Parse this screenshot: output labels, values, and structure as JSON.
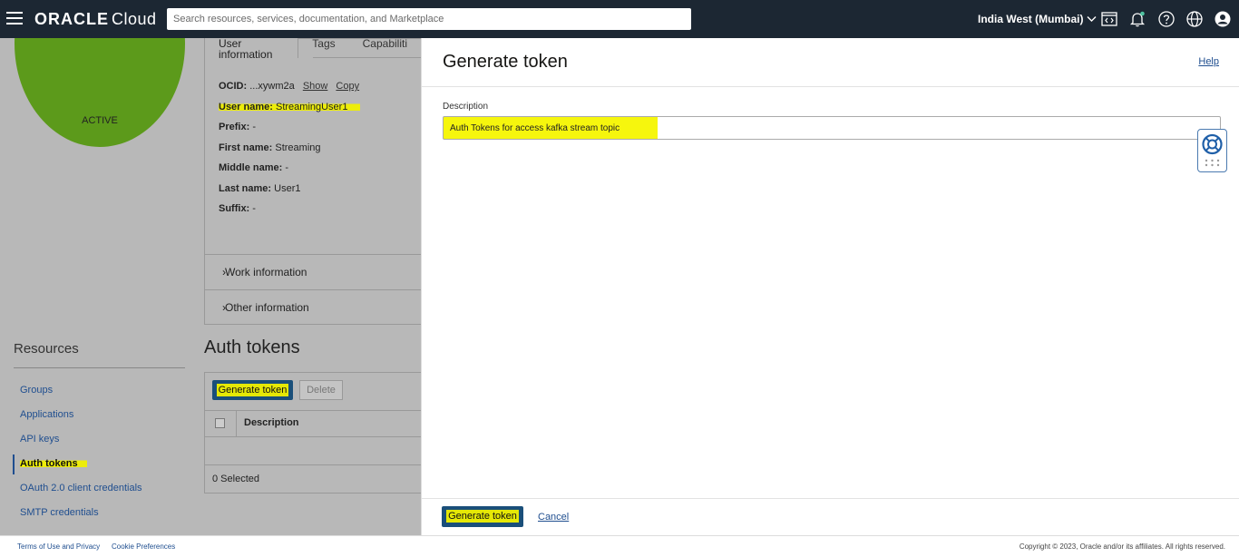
{
  "topbar": {
    "logo_oracle": "ORACLE",
    "logo_cloud": "Cloud",
    "search_placeholder": "Search resources, services, documentation, and Marketplace",
    "region": "India West (Mumbai)"
  },
  "user": {
    "status": "ACTIVE",
    "tabs": [
      "User information",
      "Tags",
      "Capabiliti"
    ],
    "ocid_label": "OCID:",
    "ocid_value": "...xywm2a",
    "ocid_show": "Show",
    "ocid_copy": "Copy",
    "username_label": "User name:",
    "username_value": "StreamingUser1",
    "prefix_label": "Prefix:",
    "prefix_value": "-",
    "firstname_label": "First name:",
    "firstname_value": "Streaming",
    "middlename_label": "Middle name:",
    "middlename_value": "-",
    "lastname_label": "Last name:",
    "lastname_value": "User1",
    "suffix_label": "Suffix:",
    "suffix_value": "-",
    "work_info": "Work information",
    "other_info": "Other information"
  },
  "resources": {
    "title": "Resources",
    "items": [
      "Groups",
      "Applications",
      "API keys",
      "Auth tokens",
      "OAuth 2.0 client credentials",
      "SMTP credentials"
    ]
  },
  "auth_tokens": {
    "title": "Auth tokens",
    "generate_label": "Generate token",
    "delete_label": "Delete",
    "col_description": "Description",
    "selected_count": "0 Selected"
  },
  "drawer": {
    "title": "Generate token",
    "help": "Help",
    "description_label": "Description",
    "description_value": "Auth Tokens for access kafka stream topic",
    "generate_label": "Generate token",
    "cancel_label": "Cancel"
  },
  "footer": {
    "terms": "Terms of Use and Privacy",
    "cookies": "Cookie Preferences",
    "copyright": "Copyright © 2023, Oracle and/or its affiliates. All rights reserved."
  }
}
